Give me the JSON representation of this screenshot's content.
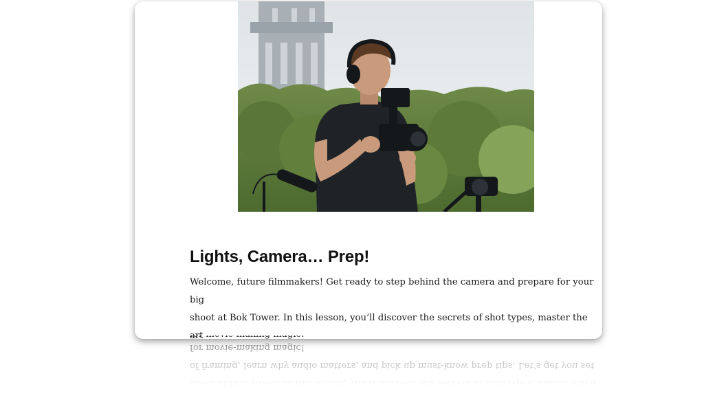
{
  "lesson": {
    "title": "Lights, Camera… Prep!",
    "intro_lines": [
      "Welcome, future filmmakers! Get ready to step behind the camera and prepare for your big",
      "shoot at Bok Tower. In this lesson, you’ll discover the secrets of shot types, master the art",
      "of framing, learn why audio matters, and pick up must-know prep tips. Let’s get you set",
      "for movie-making magic!"
    ]
  },
  "hero_image": {
    "subject": "young-filmmaker-with-camera-at-tower",
    "colors": {
      "sky": "#e9edf0",
      "tower": "#a9b2b8",
      "foliage": "#5f7a3e",
      "shirt": "#1e2226",
      "skin": "#c99a7c",
      "hair": "#5a3a22",
      "gear": "#15181b"
    }
  }
}
